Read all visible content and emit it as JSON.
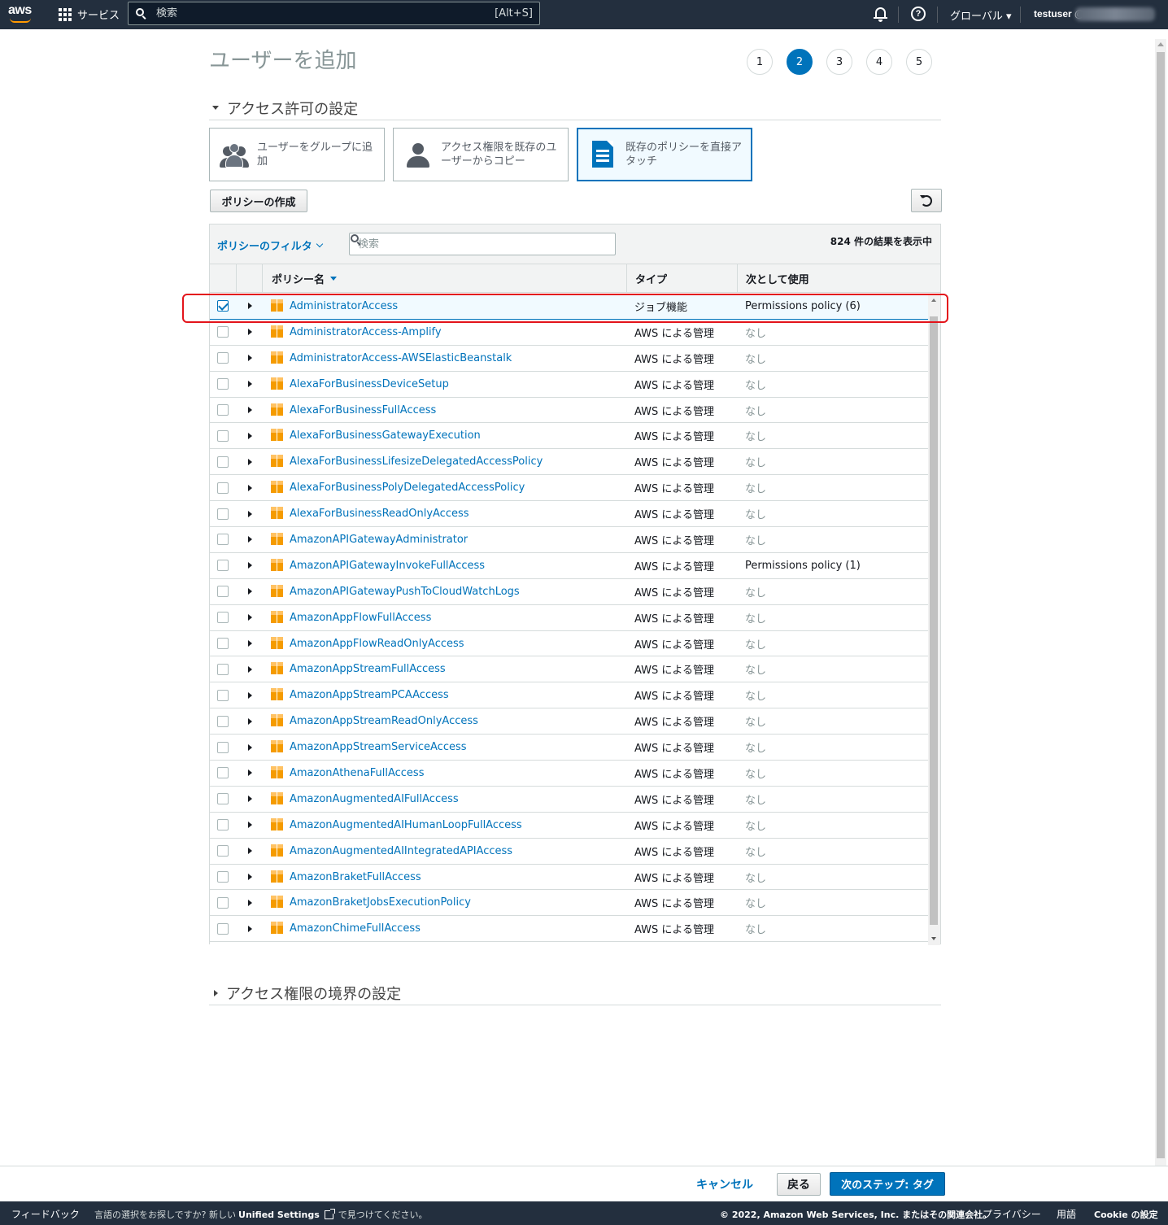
{
  "nav": {
    "logo": "aws",
    "services": "サービス",
    "search_placeholder": "検索",
    "search_shortcut": "[Alt+S]",
    "region": "グローバル ▾",
    "user": "testuser @"
  },
  "page": {
    "title": "ユーザーを追加",
    "steps": [
      "1",
      "2",
      "3",
      "4",
      "5"
    ],
    "active_step": "2"
  },
  "permissions": {
    "section_title": "アクセス許可の設定",
    "tiles": [
      {
        "label": "ユーザーをグループに追加",
        "icon": "user-group-icon"
      },
      {
        "label": "アクセス権限を既存のユーザーからコピー",
        "icon": "user-icon"
      },
      {
        "label": "既存のポリシーを直接アタッチ",
        "icon": "policy-document-icon",
        "selected": true
      }
    ],
    "create_policy_label": "ポリシーの作成",
    "filter_label": "ポリシーのフィルタ",
    "search_placeholder": "検索",
    "result_count": "824 件の結果を表示中",
    "columns": {
      "name": "ポリシー名",
      "type": "タイプ",
      "used_as": "次として使用"
    },
    "rows": [
      {
        "name": "AdministratorAccess",
        "type": "ジョブ機能",
        "used_as": "Permissions policy (6)",
        "checked": true
      },
      {
        "name": "AdministratorAccess-Amplify",
        "type": "AWS による管理",
        "used_as": "なし"
      },
      {
        "name": "AdministratorAccess-AWSElasticBeanstalk",
        "type": "AWS による管理",
        "used_as": "なし"
      },
      {
        "name": "AlexaForBusinessDeviceSetup",
        "type": "AWS による管理",
        "used_as": "なし"
      },
      {
        "name": "AlexaForBusinessFullAccess",
        "type": "AWS による管理",
        "used_as": "なし"
      },
      {
        "name": "AlexaForBusinessGatewayExecution",
        "type": "AWS による管理",
        "used_as": "なし"
      },
      {
        "name": "AlexaForBusinessLifesizeDelegatedAccessPolicy",
        "type": "AWS による管理",
        "used_as": "なし"
      },
      {
        "name": "AlexaForBusinessPolyDelegatedAccessPolicy",
        "type": "AWS による管理",
        "used_as": "なし"
      },
      {
        "name": "AlexaForBusinessReadOnlyAccess",
        "type": "AWS による管理",
        "used_as": "なし"
      },
      {
        "name": "AmazonAPIGatewayAdministrator",
        "type": "AWS による管理",
        "used_as": "なし"
      },
      {
        "name": "AmazonAPIGatewayInvokeFullAccess",
        "type": "AWS による管理",
        "used_as": "Permissions policy (1)"
      },
      {
        "name": "AmazonAPIGatewayPushToCloudWatchLogs",
        "type": "AWS による管理",
        "used_as": "なし"
      },
      {
        "name": "AmazonAppFlowFullAccess",
        "type": "AWS による管理",
        "used_as": "なし"
      },
      {
        "name": "AmazonAppFlowReadOnlyAccess",
        "type": "AWS による管理",
        "used_as": "なし"
      },
      {
        "name": "AmazonAppStreamFullAccess",
        "type": "AWS による管理",
        "used_as": "なし"
      },
      {
        "name": "AmazonAppStreamPCAAccess",
        "type": "AWS による管理",
        "used_as": "なし"
      },
      {
        "name": "AmazonAppStreamReadOnlyAccess",
        "type": "AWS による管理",
        "used_as": "なし"
      },
      {
        "name": "AmazonAppStreamServiceAccess",
        "type": "AWS による管理",
        "used_as": "なし"
      },
      {
        "name": "AmazonAthenaFullAccess",
        "type": "AWS による管理",
        "used_as": "なし"
      },
      {
        "name": "AmazonAugmentedAIFullAccess",
        "type": "AWS による管理",
        "used_as": "なし"
      },
      {
        "name": "AmazonAugmentedAIHumanLoopFullAccess",
        "type": "AWS による管理",
        "used_as": "なし"
      },
      {
        "name": "AmazonAugmentedAIIntegratedAPIAccess",
        "type": "AWS による管理",
        "used_as": "なし"
      },
      {
        "name": "AmazonBraketFullAccess",
        "type": "AWS による管理",
        "used_as": "なし"
      },
      {
        "name": "AmazonBraketJobsExecutionPolicy",
        "type": "AWS による管理",
        "used_as": "なし"
      },
      {
        "name": "AmazonChimeFullAccess",
        "type": "AWS による管理",
        "used_as": "なし"
      }
    ]
  },
  "boundary": {
    "section_title": "アクセス権限の境界の設定"
  },
  "actions": {
    "cancel": "キャンセル",
    "back": "戻る",
    "next": "次のステップ: タグ"
  },
  "footer": {
    "feedback": "フィードバック",
    "lang_text": "言語の選択をお探しですか? 新しい",
    "unified_settings": "Unified Settings",
    "lang_suffix": "で見つけてください。",
    "copyright": "© 2022, Amazon Web Services, Inc. またはその関連会社。",
    "privacy": "プライバシー",
    "terms": "用語",
    "cookie": "Cookie の設定"
  },
  "colors": {
    "nav_bg": "#232f3e",
    "accent": "#0073bb",
    "highlight": "#e3141b",
    "policy_icon": "#f59b00"
  }
}
